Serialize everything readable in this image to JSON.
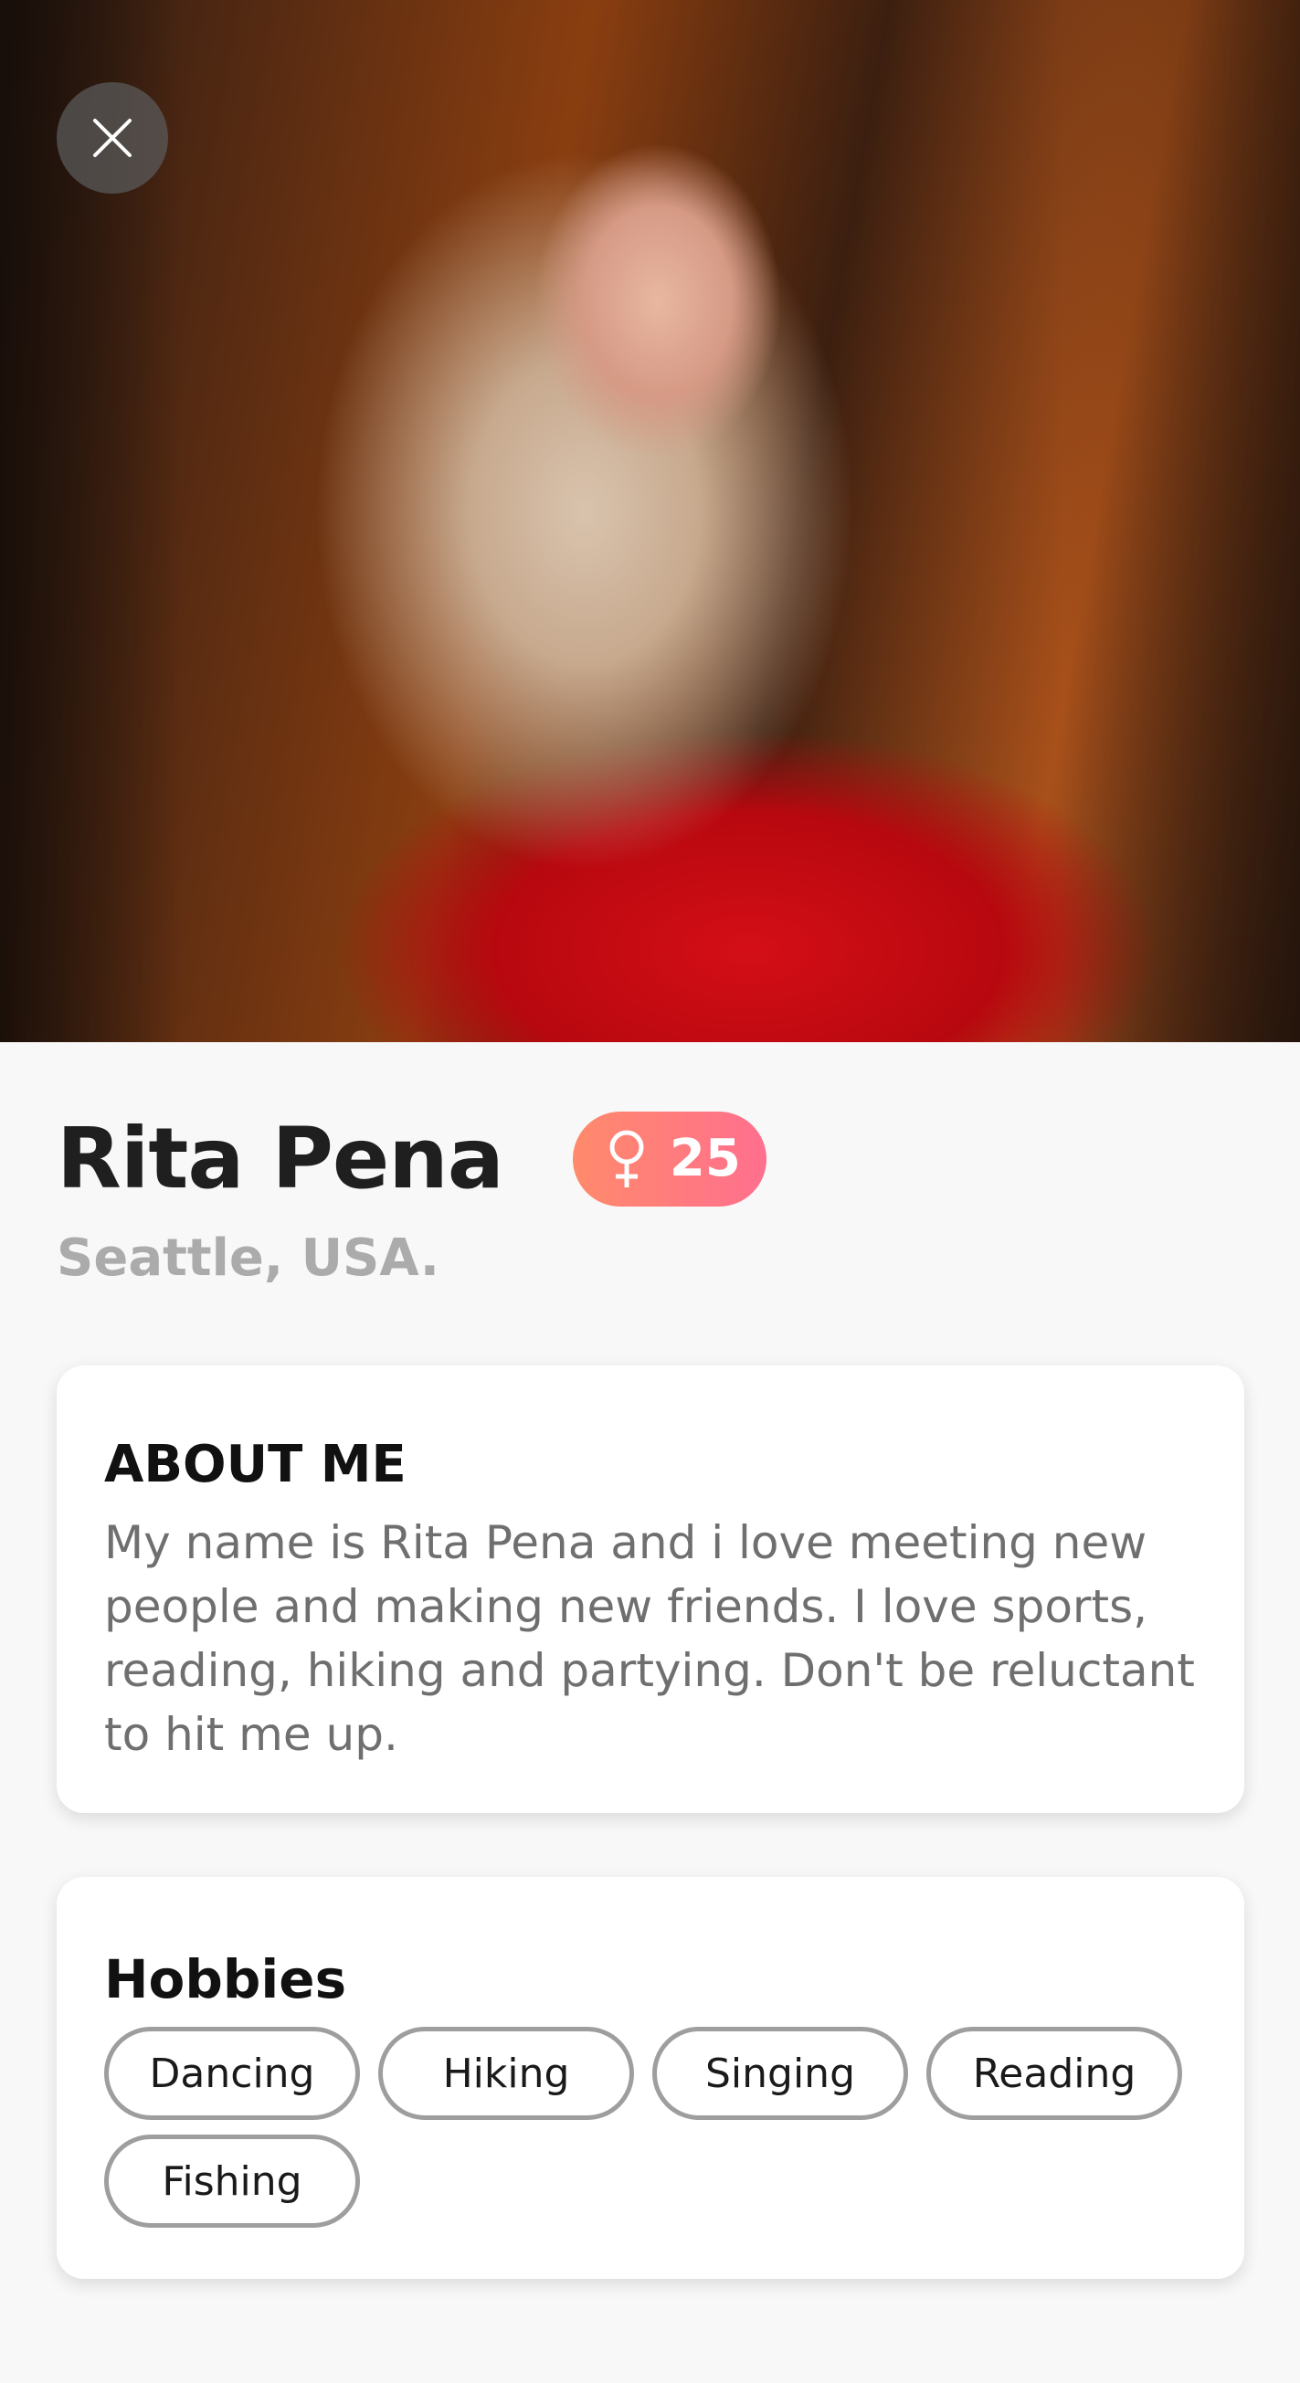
{
  "profile": {
    "name": "Rita Pena",
    "age": "25",
    "location": "Seattle, USA."
  },
  "about": {
    "title": "ABOUT ME",
    "text": "My name is Rita Pena and i love meeting new people and making new friends. I love sports, reading, hiking and partying. Don't be reluctant to hit me up."
  },
  "hobbies": {
    "title": "Hobbies",
    "items": [
      "Dancing",
      "Hiking",
      "Singing",
      "Reading",
      "Fishing"
    ]
  },
  "icons": {
    "close": "close-icon",
    "gender": "female-icon"
  },
  "colors": {
    "badge_start": "#ff8a6b",
    "badge_end": "#ff6f8e",
    "location_text": "#ababab",
    "chip_border": "#9e9e9e"
  }
}
